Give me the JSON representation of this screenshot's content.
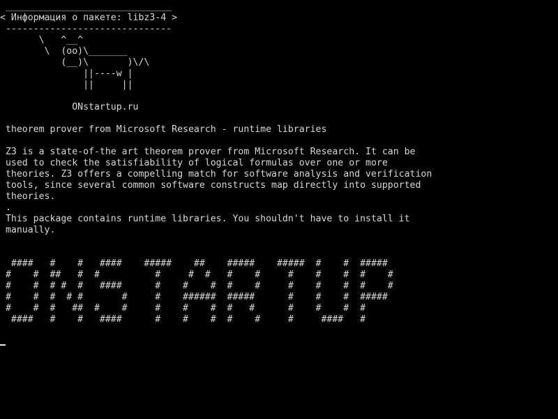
{
  "terminal": {
    "cowsay": " ______________________________\n< Информация о пакете: libz3-4 >\n ------------------------------\n       \\   ^__^\n        \\  (oo)\\_______\n           (__)\\       )\\/\\\n               ||----w |\n               ||     ||",
    "site": "             ONstartup.ru",
    "summary": " theorem prover from Microsoft Research - runtime libraries",
    "description": " Z3 is a state-of-the art theorem prover from Microsoft Research. It can be\n used to check the satisfiability of logical formulas over one or more\n theories. Z3 offers a compelling match for software analysis and verification\n tools, since several common software constructs map directly into supported\n theories.\n .\n This package contains runtime libraries. You shouldn't have to install it\n manually.",
    "banner": "  ####   #    #   ####    #####    ##    #####    #####  #    #  #####\n #    #  ##   #  #          #     #  #   #    #     #    #    #  #    #\n #    #  # #  #   ####      #    #    #  #    #     #    #    #  #    #\n #    #  #  # #       #     #    ######  #####      #    #    #  #####\n #    #  #   ##  #    #     #    #    #  #   #      #    #    #  #\n  ####   #    #   ####      #    #    #  #    #     #     ####   #"
  }
}
